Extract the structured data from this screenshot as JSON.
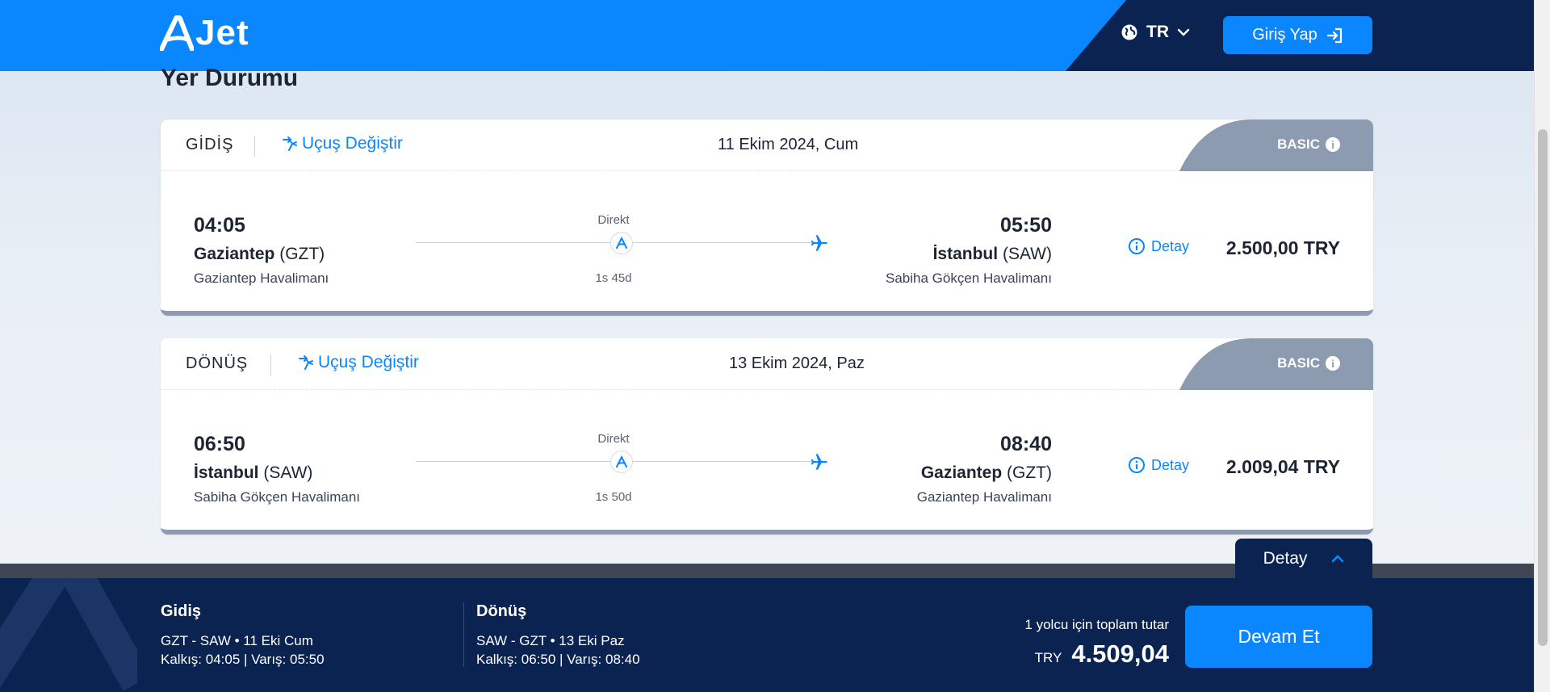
{
  "header": {
    "logo_text": "Jet",
    "language": "TR",
    "login_label": "Giriş Yap"
  },
  "page_title": "Yer Durumu",
  "flights": [
    {
      "direction": "GİDİŞ",
      "change_label": "Uçuş Değiştir",
      "date": "11 Ekim 2024, Cum",
      "fare": "BASIC",
      "dep_time": "04:05",
      "dep_city": "Gaziantep",
      "dep_code": "(GZT)",
      "dep_airport": "Gaziantep Havalimanı",
      "stop_label": "Direkt",
      "duration": "1s 45d",
      "arr_time": "05:50",
      "arr_city": "İstanbul",
      "arr_code": "(SAW)",
      "arr_airport": "Sabiha Gökçen Havalimanı",
      "detail_label": "Detay",
      "price": "2.500,00 TRY"
    },
    {
      "direction": "DÖNÜŞ",
      "change_label": "Uçuş Değiştir",
      "date": "13 Ekim 2024, Paz",
      "fare": "BASIC",
      "dep_time": "06:50",
      "dep_city": "İstanbul",
      "dep_code": "(SAW)",
      "dep_airport": "Sabiha Gökçen Havalimanı",
      "stop_label": "Direkt",
      "duration": "1s 50d",
      "arr_time": "08:40",
      "arr_city": "Gaziantep",
      "arr_code": "(GZT)",
      "arr_airport": "Gaziantep Havalimanı",
      "detail_label": "Detay",
      "price": "2.009,04 TRY"
    }
  ],
  "detail_tab_label": "Detay",
  "footer": {
    "outbound": {
      "title": "Gidiş",
      "route": "GZT - SAW • 11 Eki Cum",
      "times": "Kalkış: 04:05 | Varış: 05:50"
    },
    "return": {
      "title": "Dönüş",
      "route": "SAW - GZT • 13 Eki Paz",
      "times": "Kalkış: 06:50 | Varış: 08:40"
    },
    "total_label": "1 yolcu için toplam tutar",
    "currency": "TRY",
    "total_amount": "4.509,04",
    "continue_label": "Devam Et"
  },
  "colors": {
    "brand_blue": "#0a87ff",
    "navy": "#0b2350",
    "fare_gray": "#8d9bb0"
  }
}
